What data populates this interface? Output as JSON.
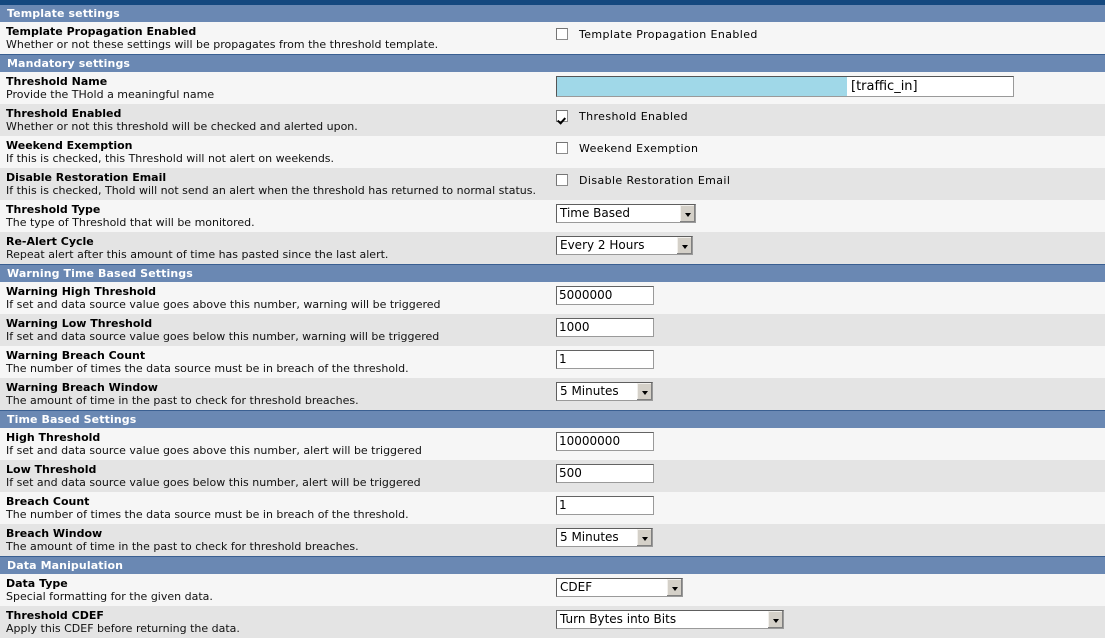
{
  "sections": [
    {
      "id": "template-settings",
      "title": "Template settings",
      "rows": [
        {
          "id": "template-propagation-enabled",
          "label": "Template Propagation Enabled",
          "description": "Whether or not these settings will be propagates from the threshold template.",
          "control": "checkbox",
          "checkbox_label": "Template Propagation Enabled",
          "checked": false
        }
      ]
    },
    {
      "id": "mandatory-settings",
      "title": "Mandatory settings",
      "rows": [
        {
          "id": "threshold-name",
          "label": "Threshold Name",
          "description": "Provide the THold a meaningful name",
          "control": "name-field",
          "value": "[traffic_in]"
        },
        {
          "id": "threshold-enabled",
          "label": "Threshold Enabled",
          "description": "Whether or not this threshold will be checked and alerted upon.",
          "control": "checkbox",
          "checkbox_label": "Threshold Enabled",
          "checked": true
        },
        {
          "id": "weekend-exemption",
          "label": "Weekend Exemption",
          "description": "If this is checked, this Threshold will not alert on weekends.",
          "control": "checkbox",
          "checkbox_label": "Weekend Exemption",
          "checked": false
        },
        {
          "id": "disable-restoration-email",
          "label": "Disable Restoration Email",
          "description": "If this is checked, Thold will not send an alert when the threshold has returned to normal status.",
          "control": "checkbox",
          "checkbox_label": "Disable Restoration Email",
          "checked": false
        },
        {
          "id": "threshold-type",
          "label": "Threshold Type",
          "description": "The type of Threshold that will be monitored.",
          "control": "select",
          "value": "Time Based",
          "width_class": "w-thrtype"
        },
        {
          "id": "re-alert-cycle",
          "label": "Re-Alert Cycle",
          "description": "Repeat alert after this amount of time has pasted since the last alert.",
          "control": "select",
          "value": "Every 2 Hours",
          "width_class": "w-realert"
        }
      ]
    },
    {
      "id": "warning-time-based-settings",
      "title": "Warning Time Based Settings",
      "rows": [
        {
          "id": "warning-high-threshold",
          "label": "Warning High Threshold",
          "description": "If set and data source value goes above this number, warning will be triggered",
          "control": "text",
          "value": "5000000"
        },
        {
          "id": "warning-low-threshold",
          "label": "Warning Low Threshold",
          "description": "If set and data source value goes below this number, warning will be triggered",
          "control": "text",
          "value": "1000"
        },
        {
          "id": "warning-breach-count",
          "label": "Warning Breach Count",
          "description": "The number of times the data source must be in breach of the threshold.",
          "control": "text",
          "value": "1"
        },
        {
          "id": "warning-breach-window",
          "label": "Warning Breach Window",
          "description": "The amount of time in the past to check for threshold breaches.",
          "control": "select",
          "value": "5 Minutes",
          "width_class": "w-window"
        }
      ]
    },
    {
      "id": "time-based-settings",
      "title": "Time Based Settings",
      "rows": [
        {
          "id": "high-threshold",
          "label": "High Threshold",
          "description": "If set and data source value goes above this number, alert will be triggered",
          "control": "text",
          "value": "10000000"
        },
        {
          "id": "low-threshold",
          "label": "Low Threshold",
          "description": "If set and data source value goes below this number, alert will be triggered",
          "control": "text",
          "value": "500"
        },
        {
          "id": "breach-count",
          "label": "Breach Count",
          "description": "The number of times the data source must be in breach of the threshold.",
          "control": "text",
          "value": "1"
        },
        {
          "id": "breach-window",
          "label": "Breach Window",
          "description": "The amount of time in the past to check for threshold breaches.",
          "control": "select",
          "value": "5 Minutes",
          "width_class": "w-window"
        }
      ]
    },
    {
      "id": "data-manipulation",
      "title": "Data Manipulation",
      "rows": [
        {
          "id": "data-type",
          "label": "Data Type",
          "description": "Special formatting for the given data.",
          "control": "select",
          "value": "CDEF",
          "width_class": "w-datatype"
        },
        {
          "id": "threshold-cdef",
          "label": "Threshold CDEF",
          "description": "Apply this CDEF before returning the data.",
          "control": "select",
          "value": "Turn Bytes into Bits",
          "width_class": "w-cdef"
        }
      ]
    }
  ],
  "colors": {
    "section_bar": "#6a88b3",
    "top_border": "#14487f",
    "row_light": "#f6f6f6",
    "row_dark": "#e4e4e4",
    "selection_highlight": "#a0d8e8"
  }
}
